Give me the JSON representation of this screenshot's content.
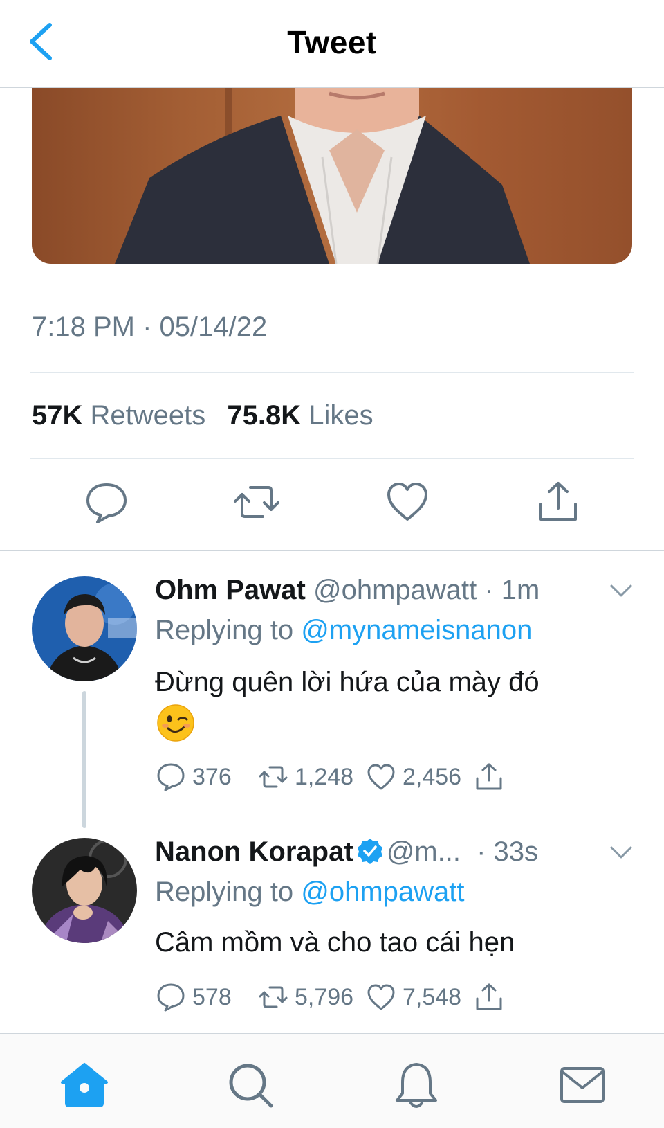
{
  "header": {
    "title": "Tweet",
    "back_icon": "chevron-left-icon",
    "accent": "#1da1f2"
  },
  "tweet": {
    "timestamp": "7:18 PM · 05/14/22",
    "retweets_count": "57K",
    "retweets_label": "Retweets",
    "likes_count": "75.8K",
    "likes_label": "Likes",
    "actions": [
      "reply-icon",
      "retweet-icon",
      "like-icon",
      "share-icon"
    ]
  },
  "replies": [
    {
      "name": "Ohm Pawat",
      "handle": "@ohmpawatt",
      "time": "· 1m",
      "verified": false,
      "replying_prefix": "Replying to ",
      "replying_to": "@mynameisnanon",
      "text": "Đừng quên lời hứa của mày đó",
      "emoji": "winking-face-emoji",
      "replies": "376",
      "retweets": "1,248",
      "likes": "2,456"
    },
    {
      "name": "Nanon Korapat",
      "handle": "@m...",
      "time": "· 33s",
      "verified": true,
      "replying_prefix": "Replying to ",
      "replying_to": "@ohmpawatt",
      "text": "Câm mồm và cho tao cái hẹn",
      "replies": "578",
      "retweets": "5,796",
      "likes": "7,548"
    }
  ],
  "tabbar": {
    "items": [
      "home-icon",
      "search-icon",
      "notifications-icon",
      "messages-icon"
    ],
    "active": "home-icon"
  }
}
